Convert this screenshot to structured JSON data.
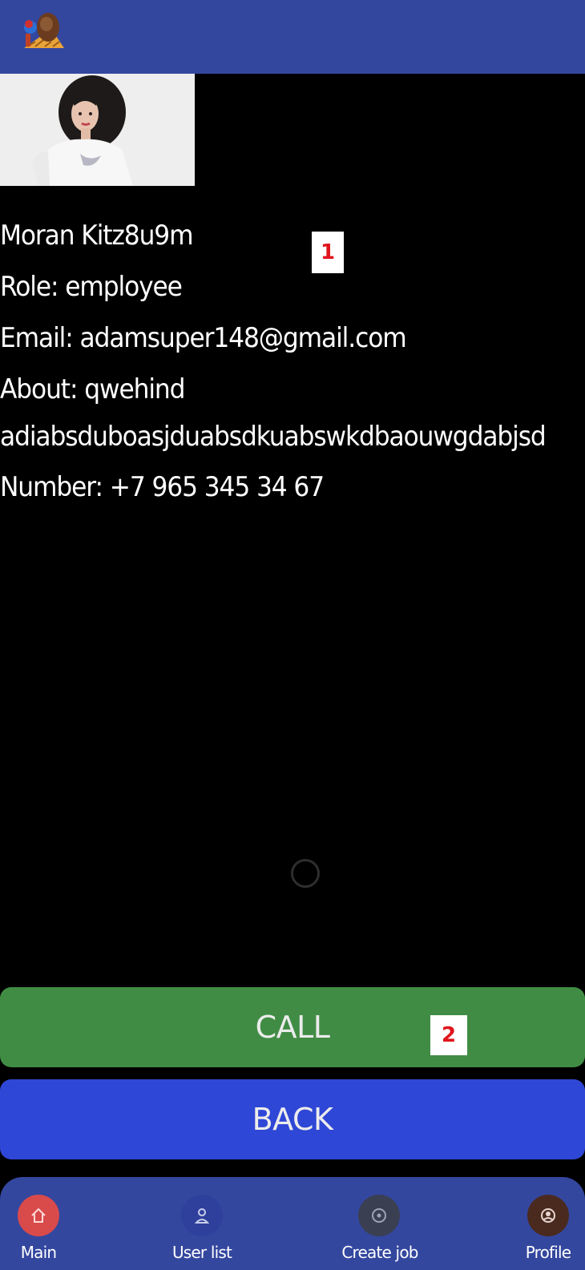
{
  "header": {
    "logo_icon": "hammer-logo-icon"
  },
  "profile": {
    "photo_icon": "profile-photo",
    "name": "Moran Kitz8u9m",
    "role": "Role: employee",
    "email": "Email: adamsuper148@gmail.com",
    "about": "About: qwehind",
    "about_cont": "adiabsduboasjduabsdkuabswkdbaouwgdabjsd",
    "number": "Number: +7 965 345 34 67"
  },
  "markers": {
    "one": "1",
    "two": "2"
  },
  "actions": {
    "call_label": "CALL",
    "back_label": "BACK",
    "call_color": "#418c45",
    "back_color": "#2f47d6"
  },
  "bottom_nav": {
    "items": [
      {
        "label": "Main",
        "icon": "home-icon",
        "color": "#d94a4a"
      },
      {
        "label": "User list",
        "icon": "user-icon",
        "color": "#2f3f9c"
      },
      {
        "label": "Create job",
        "icon": "add-circle-icon",
        "color": "#3a3f52"
      },
      {
        "label": "Profile",
        "icon": "profile-icon",
        "color": "#4a2a1f"
      }
    ]
  },
  "colors": {
    "primary": "#34479f",
    "background": "#000000"
  }
}
